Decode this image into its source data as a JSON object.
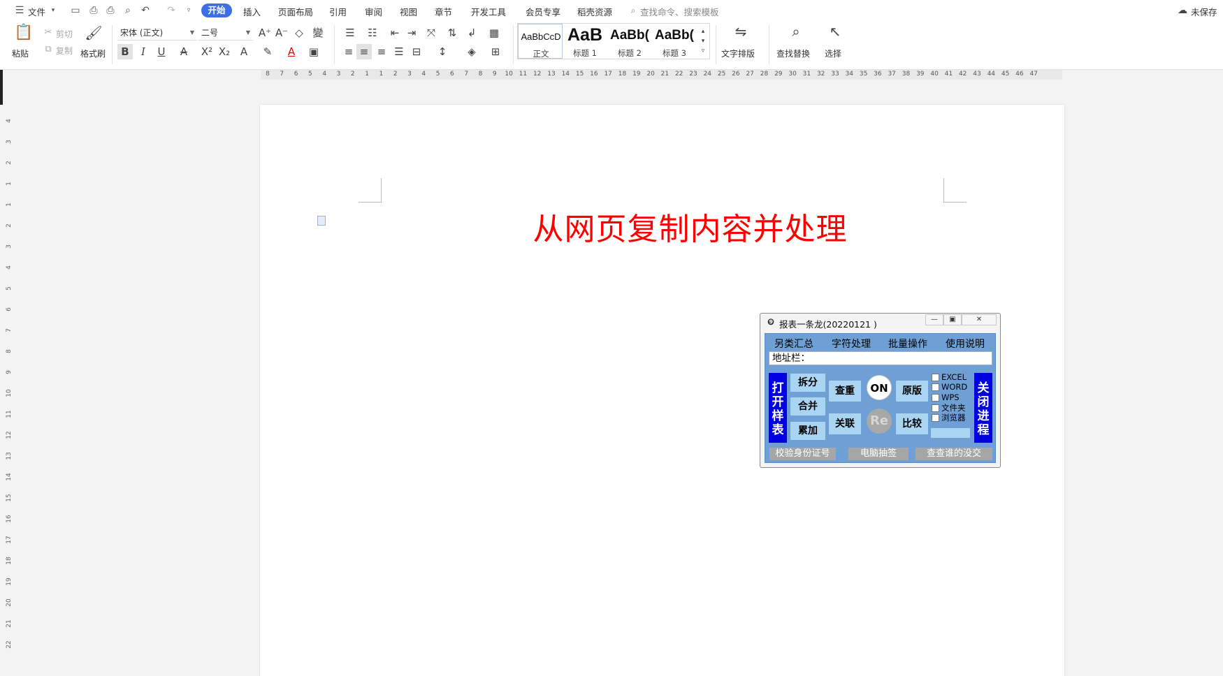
{
  "menubar": {
    "file": "文件",
    "tabs": [
      "开始",
      "插入",
      "页面布局",
      "引用",
      "审阅",
      "视图",
      "章节",
      "开发工具",
      "会员专享",
      "稻壳资源"
    ],
    "search_placeholder": "查找命令、搜索模板",
    "status": "未保存"
  },
  "ribbon": {
    "paste": "粘贴",
    "cut": "剪切",
    "copy": "复制",
    "format_painter": "格式刷",
    "font_name": "宋体 (正文)",
    "font_size": "二号",
    "styles": [
      {
        "sample": "AaBbCcD",
        "name": "正文"
      },
      {
        "sample": "AaB",
        "name": "标题 1"
      },
      {
        "sample": "AaBb(",
        "name": "标题 2"
      },
      {
        "sample": "AaBb(",
        "name": "标题 3"
      }
    ],
    "text_layout": "文字排版",
    "find_replace": "查找替换",
    "select": "选择"
  },
  "ruler": {
    "ticks": [
      "8",
      "7",
      "6",
      "5",
      "4",
      "3",
      "2",
      "1",
      "1",
      "2",
      "3",
      "4",
      "5",
      "6",
      "7",
      "8",
      "9",
      "10",
      "11",
      "12",
      "13",
      "14",
      "15",
      "16",
      "17",
      "18",
      "19",
      "20",
      "21",
      "22",
      "23",
      "24",
      "25",
      "26",
      "27",
      "28",
      "29",
      "30",
      "31",
      "32",
      "33",
      "34",
      "35",
      "36",
      "37",
      "38",
      "39",
      "40",
      "41",
      "42",
      "43",
      "44",
      "45",
      "46",
      "47"
    ],
    "vticks": [
      "4",
      "3",
      "2",
      "1",
      "1",
      "2",
      "3",
      "4",
      "5",
      "6",
      "7",
      "8",
      "9",
      "10",
      "11",
      "12",
      "13",
      "14",
      "15",
      "16",
      "17",
      "18",
      "19",
      "20",
      "21",
      "22"
    ]
  },
  "document": {
    "title": "从网页复制内容并处理"
  },
  "dialog": {
    "title": "报表一条龙(20220121 )",
    "menu": [
      "另类汇总",
      "字符处理",
      "批量操作",
      "使用说明"
    ],
    "address_label": "地址栏：",
    "open_sample": "打开样表",
    "close_process": "关闭进程",
    "split": "拆分",
    "merge": "合并",
    "accumulate": "累加",
    "dedup": "查重",
    "relate": "关联",
    "on": "ON",
    "re": "Re",
    "original": "原版",
    "compare": "比较",
    "checks": [
      "EXCEL",
      "WORD",
      "WPS",
      "文件夹",
      "浏览器"
    ],
    "bottom": [
      "校验身份证号",
      "电脑抽签",
      "查查谁的没交"
    ]
  },
  "colors": {
    "accent": "#3c6fe6",
    "title_red": "#ff0000",
    "dialog_blue": "#6ea0d5",
    "button_blue": "#a9d4f2",
    "vbutton_blue": "#0000e0"
  }
}
